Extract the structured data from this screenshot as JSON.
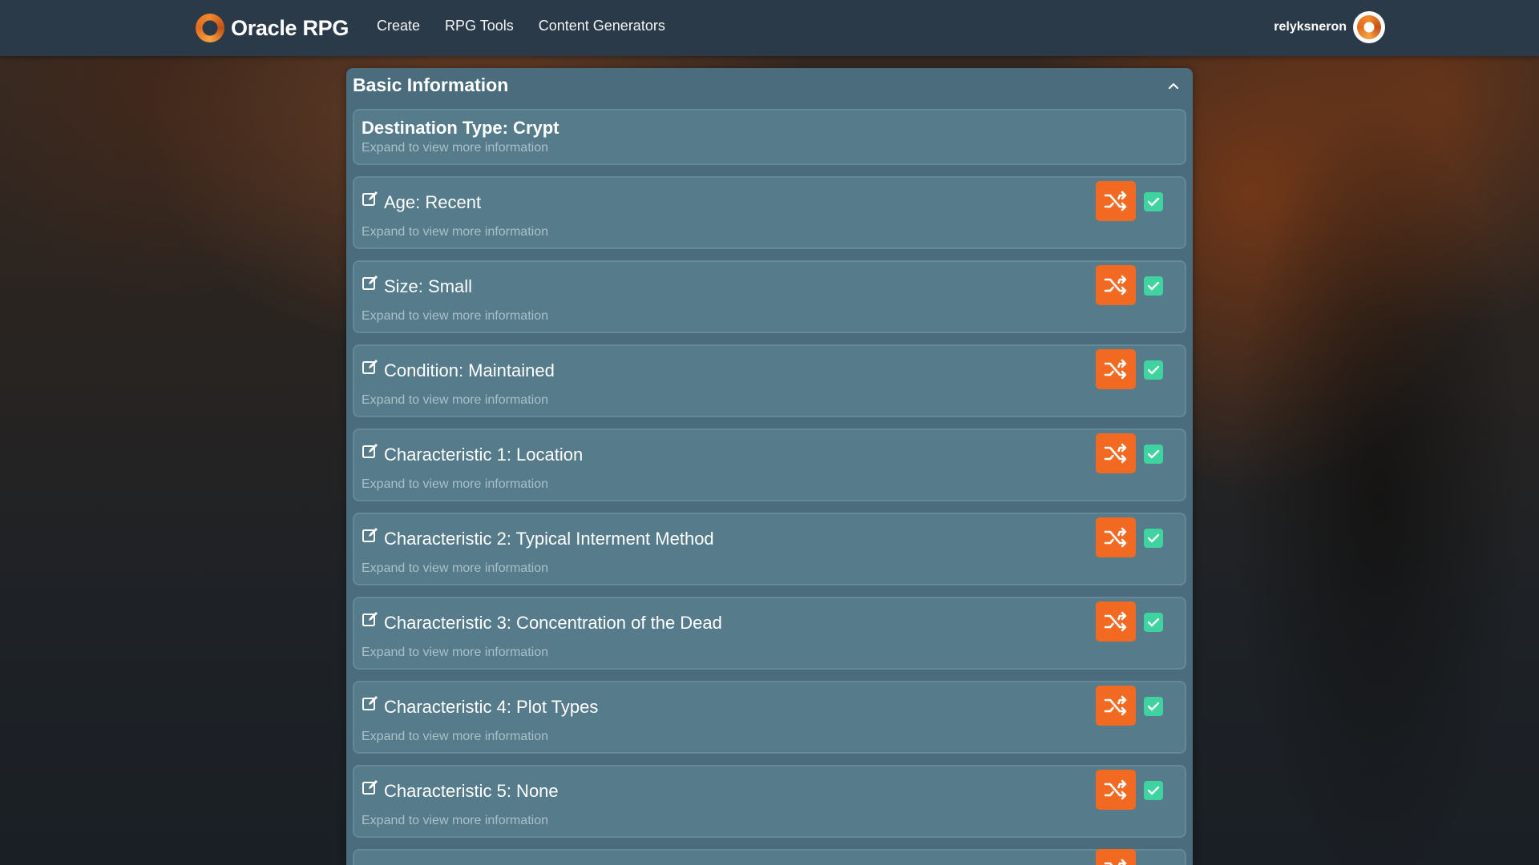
{
  "app": {
    "brand_name": "Oracle RPG",
    "nav": [
      "Create",
      "RPG Tools",
      "Content Generators"
    ],
    "username": "relyksneron"
  },
  "colors": {
    "navbar": "#2b3a49",
    "panel": "#4a6c7c",
    "card": "#567b8a",
    "shuffle_button": "#f26a21",
    "checkbox": "#3fd3a0"
  },
  "panel": {
    "title": "Basic Information",
    "expanded": true,
    "collapse_icon": "chevron-up-icon"
  },
  "destination": {
    "title": "Destination Type: Crypt",
    "subtitle": "Expand to view more information"
  },
  "items": [
    {
      "title": "Age: Recent",
      "subtitle": "Expand to view more information",
      "checked": true
    },
    {
      "title": "Size: Small",
      "subtitle": "Expand to view more information",
      "checked": true
    },
    {
      "title": "Condition: Maintained",
      "subtitle": "Expand to view more information",
      "checked": true
    },
    {
      "title": "Characteristic 1: Location",
      "subtitle": "Expand to view more information",
      "checked": true
    },
    {
      "title": "Characteristic 2: Typical Interment Method",
      "subtitle": "Expand to view more information",
      "checked": true
    },
    {
      "title": "Characteristic 3: Concentration of the Dead",
      "subtitle": "Expand to view more information",
      "checked": true
    },
    {
      "title": "Characteristic 4: Plot Types",
      "subtitle": "Expand to view more information",
      "checked": true
    },
    {
      "title": "Characteristic 5: None",
      "subtitle": "Expand to view more information",
      "checked": true
    }
  ],
  "icons": {
    "edit": "edit-icon",
    "shuffle": "shuffle-icon",
    "check": "checkmark-icon"
  }
}
